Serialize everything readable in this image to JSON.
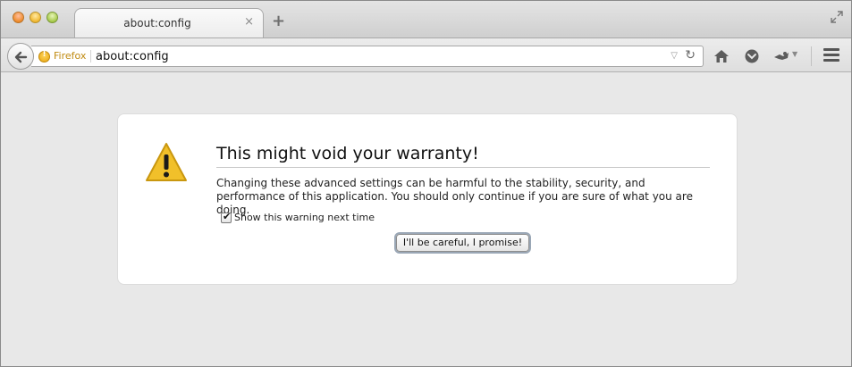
{
  "window": {
    "controls": [
      "close",
      "minimize",
      "zoom"
    ]
  },
  "tab": {
    "title": "about:config",
    "close_glyph": "×",
    "new_tab_glyph": "+"
  },
  "navbar": {
    "identity_label": "Firefox",
    "url": "about:config",
    "dropdown_glyph": "▽",
    "reload_glyph": "↻",
    "icons": [
      "back-icon",
      "home-icon",
      "pocket-icon",
      "addon-icon",
      "menu-icon"
    ]
  },
  "dialog": {
    "title": "This might void your warranty!",
    "message": "Changing these advanced settings can be harmful to the stability, security, and performance of this application. You should only continue if you are sure of what you are doing.",
    "checkbox_label": "Show this warning next time",
    "checkbox_checked": true,
    "button_label": "I'll be careful, I promise!"
  },
  "colors": {
    "warning_yellow": "#f1c02a",
    "identity_orange": "#c08a10"
  }
}
